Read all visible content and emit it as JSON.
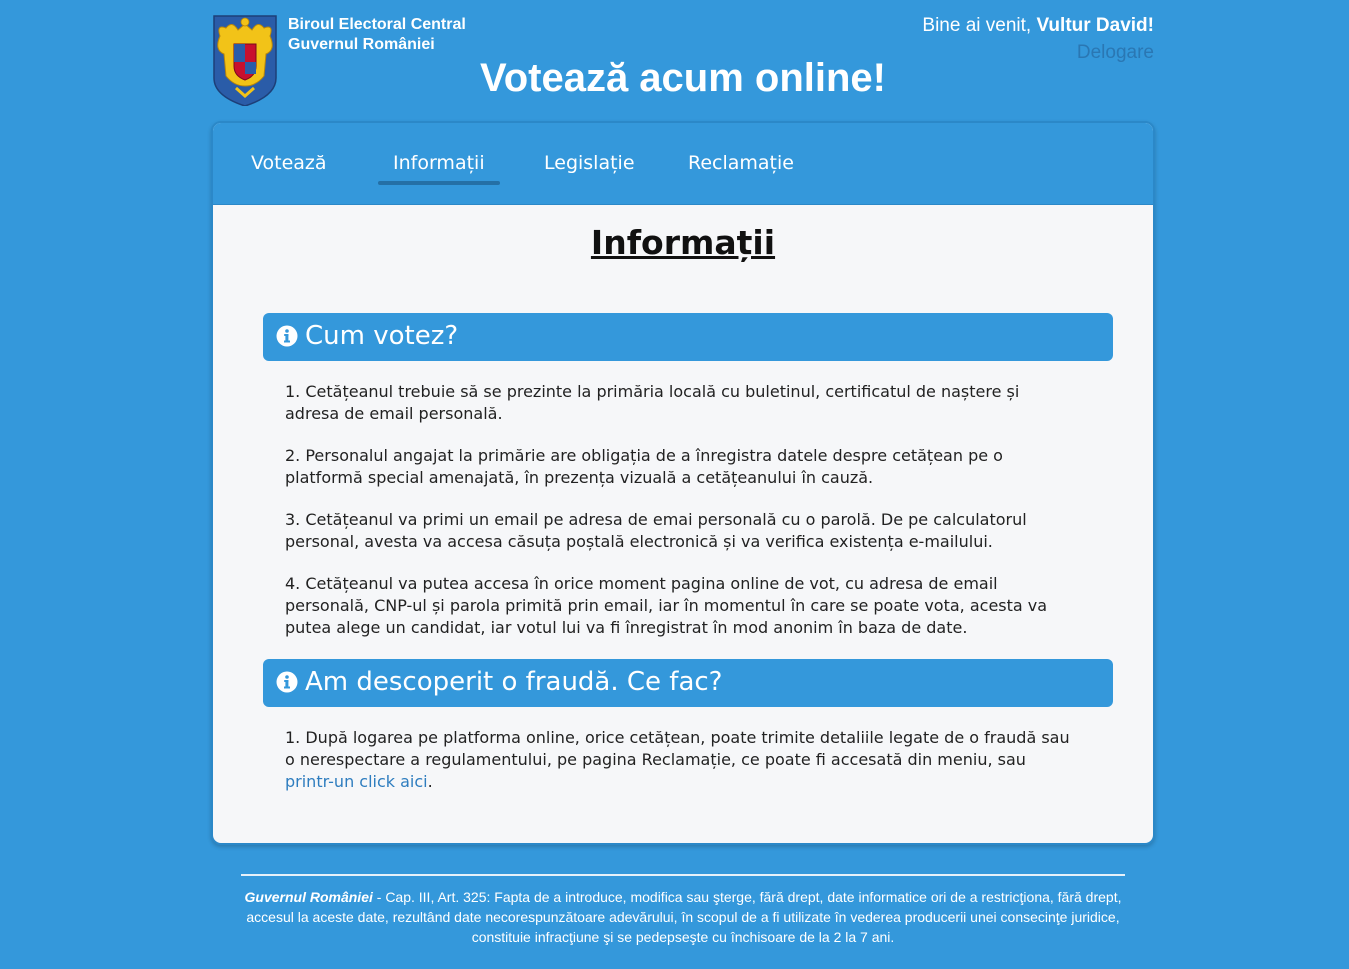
{
  "header": {
    "org_line1": "Biroul Electoral Central",
    "org_line2": "Guvernul României",
    "welcome_prefix": "Bine ai venit, ",
    "user_name": "Vultur David!",
    "logout_label": "Delogare",
    "main_title": "Votează acum online!"
  },
  "nav": {
    "items": [
      {
        "label": "Votează"
      },
      {
        "label": "Informații"
      },
      {
        "label": "Legislație"
      },
      {
        "label": "Reclamație"
      }
    ],
    "active": "Informații"
  },
  "content": {
    "page_title": "Informații",
    "sections": [
      {
        "title": "Cum votez?",
        "paragraphs": [
          "1. Cetățeanul trebuie să se prezinte la primăria locală cu buletinul, certificatul de naștere și adresa de email personală.",
          "2. Personalul angajat la primărie are obligația de a înregistra datele despre cetățean pe o platformă special amenajată, în prezența vizuală a cetățeanului în cauză.",
          "3. Cetățeanul va primi un email pe adresa de emai personală cu o parolă. De pe calculatorul personal, avesta va accesa căsuța poștală electronică și va verifica existența e-mailului.",
          "4. Cetățeanul va putea accesa în orice moment pagina online de vot, cu adresa de email personală, CNP-ul și parola primită prin email, iar în momentul în care se poate vota, acesta va putea alege un candidat, iar votul lui va fi înregistrat în mod anonim în baza de date."
        ]
      },
      {
        "title": "Am descoperit o fraudă. Ce fac?",
        "paragraphs": [
          "1. După logarea pe platforma online, orice cetățean, poate trimite detaliile legate de o fraudă sau o nerespectare a regulamentului, pe pagina Reclamație, ce poate fi accesată din meniu, sau "
        ],
        "link_text": "printr-un click aici",
        "link_suffix": "."
      }
    ]
  },
  "footer": {
    "source": "Guvernul României",
    "text": " - Cap. III, Art. 325: Fapta de a introduce, modifica sau şterge, fără drept, date informatice ori de a restricţiona, fără drept, accesul la aceste date, rezultând date necorespunzătoare adevărului, în scopul de a fi utilizate în vederea producerii unei consecinţe juridice, constituie infracţiune şi se pedepseşte cu închisoare de la 2 la 7 ani."
  },
  "colors": {
    "background": "#3498db",
    "card": "#f6f7f9",
    "link": "#2e7dbf",
    "logout": "#2a77b3"
  },
  "icons": [
    "coat-of-arms-icon",
    "info-circle-icon"
  ]
}
